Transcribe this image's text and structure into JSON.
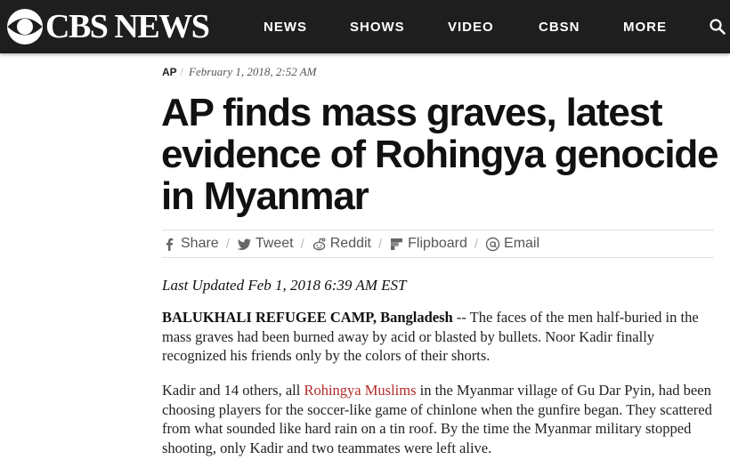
{
  "header": {
    "logo_text": "CBS NEWS",
    "nav": [
      "NEWS",
      "SHOWS",
      "VIDEO",
      "CBSN",
      "MORE"
    ]
  },
  "article": {
    "source": "AP",
    "date": "February 1, 2018, 2:52 AM",
    "headline": "AP finds mass graves, latest evidence of Rohingya genocide in Myanmar",
    "share": [
      "Share",
      "Tweet",
      "Reddit",
      "Flipboard",
      "Email"
    ],
    "updated": "Last Updated Feb 1, 2018 6:39 AM EST",
    "p1_dateline": "BALUKHALI REFUGEE CAMP, Bangladesh",
    "p1_text": " -- The faces of the men half-buried in the mass graves had been burned away by acid or blasted by bullets. Noor Kadir finally recognized his friends only by the colors of their shorts.",
    "p2_before": "Kadir and 14 others, all ",
    "p2_link": "Rohingya Muslims",
    "p2_after": " in the Myanmar village of Gu Dar Pyin, had been choosing players for the soccer-like game of chinlone when the gunfire began. They scattered from what sounded like hard rain on a tin roof. By the time the Myanmar military stopped shooting, only Kadir and two teammates were left alive."
  },
  "colors": {
    "header_bg": "#1e1e1e",
    "link": "#b32b2b",
    "icon_gray": "#555555"
  },
  "icons": [
    "cbs-eye-icon",
    "search-icon",
    "facebook-icon",
    "twitter-icon",
    "reddit-icon",
    "flipboard-icon",
    "email-icon"
  ]
}
